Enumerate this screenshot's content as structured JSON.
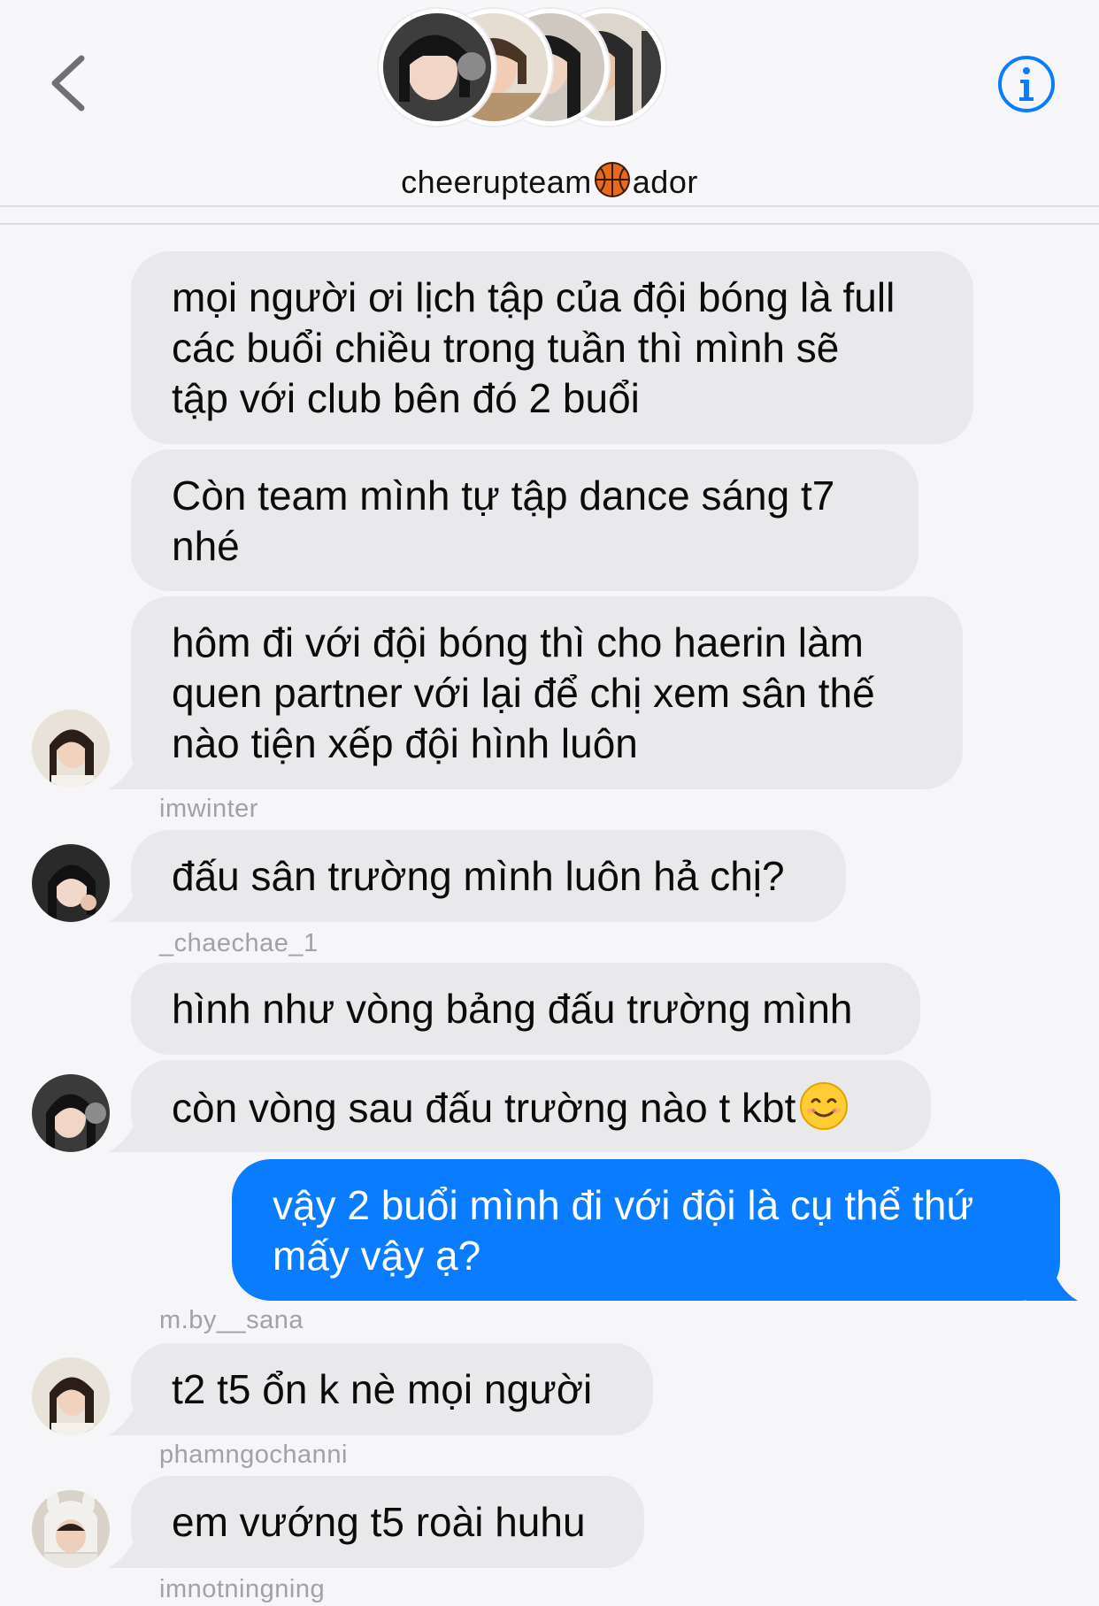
{
  "header": {
    "group_name_part1": "cheerupteam",
    "group_name_part2": "ador",
    "back_icon": "chevron-left-icon",
    "info_icon": "info-circle-icon",
    "emoji_icon": "basketball-icon"
  },
  "colors": {
    "accent": "#0a7cff",
    "received_bubble": "#e9e9eb",
    "background": "#f6f6f8",
    "sender_label": "#a1a1a6"
  },
  "messages": [
    {
      "text": "mọi người ơi lịch tập của đội bóng là full\ncác buổi chiều trong tuần thì mình sẽ\ntập với club bên đó 2 buổi",
      "outgoing": false
    },
    {
      "text": "Còn team mình tự tập dance sáng t7\nnhé",
      "outgoing": false
    },
    {
      "text": "hôm đi với đội bóng thì cho haerin làm\nquen partner với lại để chị xem sân thế\nnào tiện xếp đội hình luôn",
      "outgoing": false
    },
    {
      "text": "đấu sân trường mình luôn hả chị?",
      "outgoing": false
    },
    {
      "text": "hình như vòng bảng đấu trường mình",
      "outgoing": false
    },
    {
      "text": "còn vòng sau đấu trường nào t kbt",
      "outgoing": false,
      "emoji": "smiling-face-icon"
    },
    {
      "text": "vậy 2 buổi mình đi với đội là cụ thể thứ\nmấy vậy ạ?",
      "outgoing": true
    },
    {
      "text": "t2 t5 ổn k nè mọi người",
      "outgoing": false
    },
    {
      "text": "em vướng t5 roài huhu",
      "outgoing": false
    }
  ],
  "senders": [
    "imwinter",
    "_chaechae_1",
    "m.by__sana",
    "phamngochanni",
    "imnotningning"
  ]
}
